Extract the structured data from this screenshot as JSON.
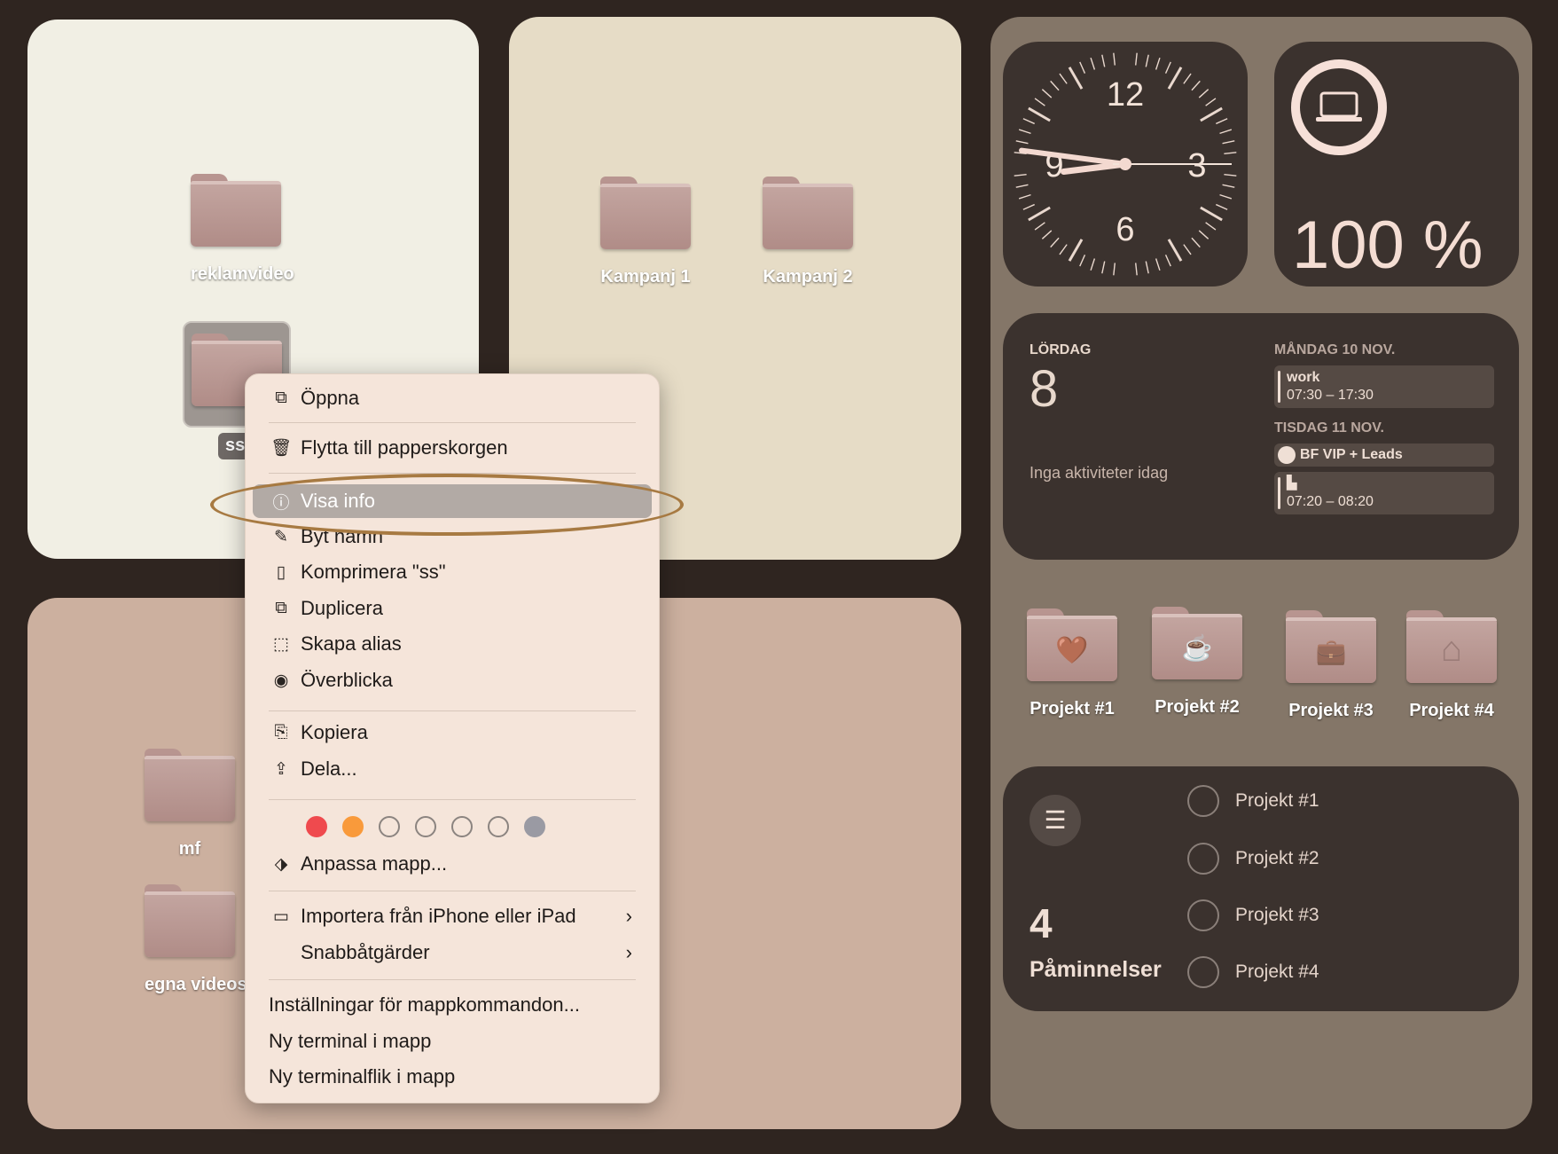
{
  "desktop": {
    "panel_a_folders": [
      {
        "label": "reklamvideo"
      },
      {
        "label": "ss"
      }
    ],
    "panel_b_folders": [
      {
        "label": "Kampanj 1"
      },
      {
        "label": "Kampanj 2"
      }
    ],
    "panel_c_folders": [
      {
        "label": "mf"
      },
      {
        "label": "egna videos"
      }
    ]
  },
  "context_menu": {
    "open": {
      "icon": "open-icon",
      "label": "Öppna"
    },
    "trash": {
      "icon": "trash-icon",
      "label": "Flytta till papperskorgen"
    },
    "get_info": {
      "icon": "info-icon",
      "label": "Visa info"
    },
    "rename": {
      "icon": "pencil-icon",
      "label": "Byt namn"
    },
    "compress": {
      "icon": "archive-icon",
      "label": "Komprimera \"ss\""
    },
    "duplicate": {
      "icon": "duplicate-icon",
      "label": "Duplicera"
    },
    "make_alias": {
      "icon": "alias-icon",
      "label": "Skapa alias"
    },
    "quick_look": {
      "icon": "eye-icon",
      "label": "Överblicka"
    },
    "copy": {
      "icon": "copy-icon",
      "label": "Kopiera"
    },
    "share": {
      "icon": "share-icon",
      "label": "Dela..."
    },
    "tag_colors": [
      "#ef4a4e",
      "#f99a3b",
      "none",
      "none",
      "none",
      "none",
      "#9a9aa3"
    ],
    "customize_folder": {
      "icon": "tag-icon",
      "label": "Anpassa mapp..."
    },
    "import_iphone": {
      "icon": "devices-icon",
      "label": "Importera från iPhone eller iPad"
    },
    "quick_actions": {
      "label": "Snabbåtgärder"
    },
    "folder_services_settings": {
      "label": "Inställningar för mappkommandon..."
    },
    "new_terminal": {
      "label": "Ny terminal i mapp"
    },
    "new_terminal_tab": {
      "label": "Ny terminalflik i mapp"
    }
  },
  "clock_widget": {
    "numerals": {
      "twelve": "12",
      "three": "3",
      "six": "6",
      "nine": "9"
    },
    "time": {
      "hour": 8,
      "minute": 46,
      "second": 15
    }
  },
  "battery_widget": {
    "icon": "laptop-icon",
    "percent_text": "100 %",
    "level": 1.0
  },
  "calendar_widget": {
    "today_weekday": "LÖRDAG",
    "today_date": "8",
    "no_events": "Inga aktiviteter idag",
    "day1_header": "MÅNDAG 10 NOV.",
    "day1_event_title": "work",
    "day1_event_time": "07:30 – 17:30",
    "day2_header": "TISDAG 11 NOV.",
    "day2_event1_title": "BF VIP + Leads",
    "day2_event2_icon": "car-icon",
    "day2_event2_time": "07:20 – 08:20"
  },
  "project_folders": [
    {
      "label": "Projekt #1",
      "icon": "heart-icon",
      "glyph": "🤎"
    },
    {
      "label": "Projekt #2",
      "icon": "coffee-icon",
      "glyph": "☕"
    },
    {
      "label": "Projekt #3",
      "icon": "briefcase-icon",
      "glyph": "💼"
    },
    {
      "label": "Projekt #4",
      "icon": "house-icon",
      "glyph": "⌂"
    }
  ],
  "reminders_widget": {
    "icon": "list-icon",
    "count": "4",
    "title": "Påminnelser",
    "items": [
      {
        "label": "Projekt #1"
      },
      {
        "label": "Projekt #2"
      },
      {
        "label": "Projekt #3"
      },
      {
        "label": "Projekt #4"
      }
    ]
  }
}
